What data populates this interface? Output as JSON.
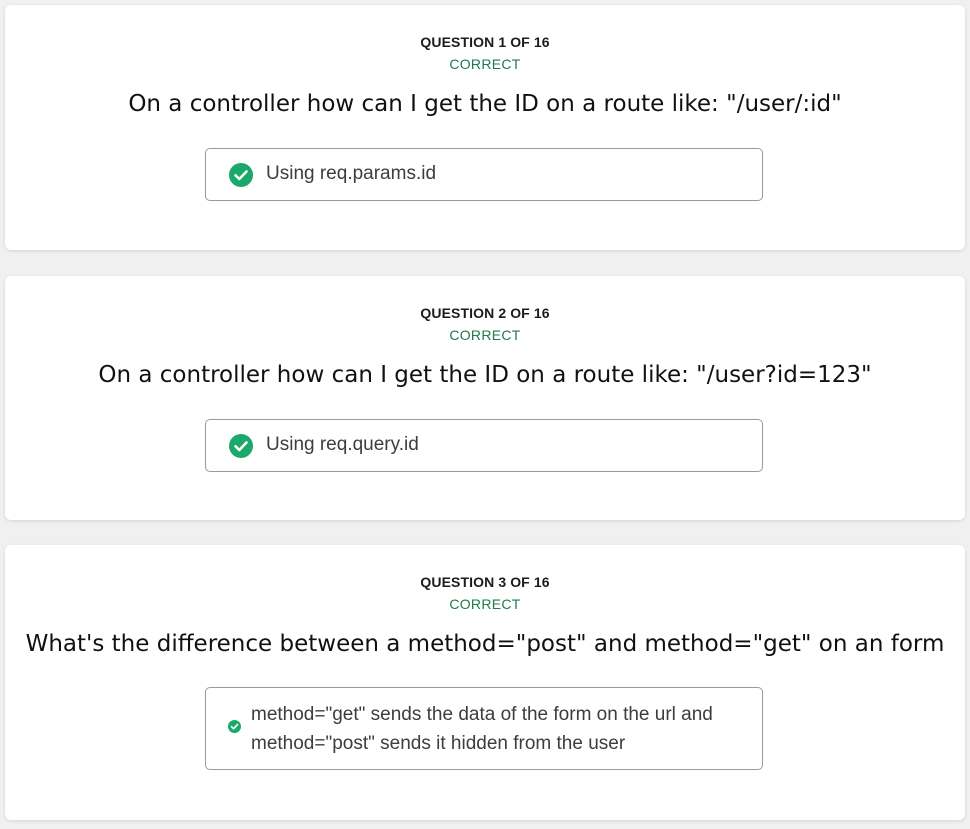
{
  "questions": [
    {
      "count": "QUESTION 1 OF 16",
      "status": "CORRECT",
      "text": "On a controller how can I get the ID on a route like: \"/user/:id\"",
      "answer": "Using req.params.id"
    },
    {
      "count": "QUESTION 2 OF 16",
      "status": "CORRECT",
      "text": "On a controller how can I get the ID on a route like: \"/user?id=123\"",
      "answer": "Using req.query.id"
    },
    {
      "count": "QUESTION 3 OF 16",
      "status": "CORRECT",
      "text": "What's the difference between a method=\"post\" and method=\"get\" on an form",
      "answer": "method=\"get\" sends the data of the form on the url and method=\"post\" sends it hidden from the user"
    }
  ],
  "colors": {
    "correct_text": "#1f7a4d",
    "check_icon": "#1aa86b"
  },
  "icons": {
    "answer_status": "check-circle-icon"
  }
}
